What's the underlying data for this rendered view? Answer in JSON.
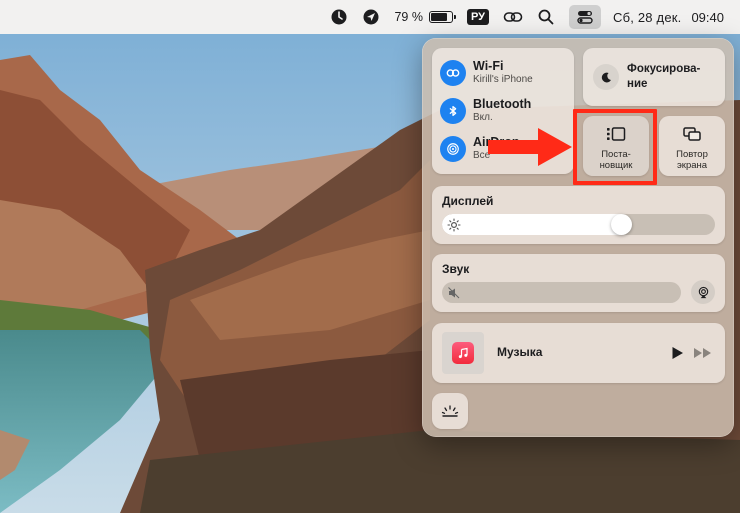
{
  "menubar": {
    "battery_percent": "79 %",
    "battery_level": 0.79,
    "input_source": "РУ",
    "date": "Сб, 28 дек.",
    "time": "09:40",
    "icons": [
      "screen-time-icon",
      "location-icon",
      "battery-icon",
      "input-source-icon",
      "hotspot-link-icon",
      "search-icon",
      "control-center-icon"
    ]
  },
  "control_center": {
    "wifi": {
      "title": "Wi-Fi",
      "subtitle": "Kirill's iPhone",
      "icon": "wifi-icon"
    },
    "bluetooth": {
      "title": "Bluetooth",
      "subtitle": "Вкл.",
      "icon": "bluetooth-icon"
    },
    "airdrop": {
      "title": "AirDrop",
      "subtitle": "Все",
      "icon": "airdrop-icon"
    },
    "focus": {
      "label": "Фокусирова-ние",
      "icon": "moon-icon"
    },
    "stage_manager": {
      "label": "Поста-новщик",
      "icon": "stage-manager-icon"
    },
    "screen_mirroring": {
      "label": "Повтор экрана",
      "icon": "screen-mirroring-icon"
    },
    "display": {
      "title": "Дисплей",
      "brightness": 0.67,
      "icon": "sun-icon"
    },
    "sound": {
      "title": "Звук",
      "volume": 0.0,
      "icon": "speaker-muted-icon"
    },
    "music": {
      "title": "Музыка",
      "icon": "music-note-icon"
    },
    "keyboard_brightness_icon": "keyboard-brightness-icon"
  },
  "colors": {
    "accent_blue": "#1e82f0",
    "highlight_red": "#ff2a17",
    "music_red": "#f22b3c"
  }
}
